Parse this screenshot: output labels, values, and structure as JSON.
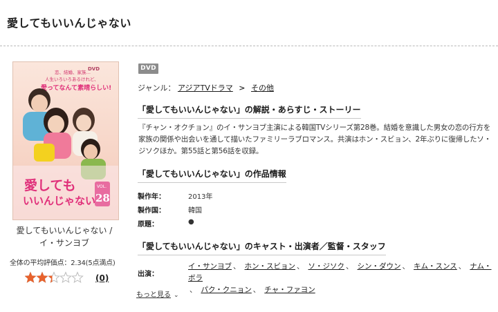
{
  "page": {
    "title": "愛してもいいんじゃない"
  },
  "product": {
    "cover_alt": "愛してもいいんじゃない DVD cover",
    "cover_text": {
      "tagline_line1": "恋、結婚、家族…",
      "tagline_line2": "人生いろいろあるけれど、",
      "tagline_line3": "愛ってなんて素晴らしい!",
      "logo_line1": "愛しても",
      "logo_line2": "いいんじゃない",
      "vol_label": "VOL.",
      "vol_number": "28"
    },
    "name": "愛してもいいんじゃない / イ・サンヨブ",
    "rating_summary": "全体の平均評価点：2.34(5点満点)",
    "rating_value": 2.34,
    "rating_max": 5,
    "review_count": "(0)",
    "format_badge": "DVD"
  },
  "genre": {
    "label": "ジャンル：",
    "items": [
      "アジアTVドラマ",
      "その他"
    ],
    "separator": ">"
  },
  "sections": {
    "synopsis_heading": "「愛してもいいんじゃない」の解説・あらすじ・ストーリー",
    "synopsis_text": "『チャン・オクチョン』のイ・サンヨブ主演による韓国TVシリーズ第28巻。結婚を意識した男女の恋の行方を家族の関係や出会いを通して描いたファミリーラブロマンス。共演はホン・スビョン、2年ぶりに復帰したソ・ジソクほか。第55話と第56話を収録。",
    "info_heading": "「愛してもいいんじゃない」の作品情報",
    "cast_heading": "「愛してもいいんじゃない」のキャスト・出演者／監督・スタッフ"
  },
  "info": {
    "year_label": "製作年：",
    "year_value": "2013年",
    "country_label": "製作国：",
    "country_value": "韓国",
    "original_label": "原題：",
    "original_value": "●"
  },
  "cast": {
    "label": "出演：",
    "names": [
      "イ・サンヨブ",
      "ホン・スビョン",
      "ソ・ジソク",
      "シン・ダウン",
      "キム・スンス",
      "ナム・ボラ",
      "パク・クニョン",
      "チャ・ファヨン"
    ],
    "comma": "、",
    "more_label": "もっと見る"
  },
  "colors": {
    "star_filled": "#e8622c",
    "star_empty": "#bdbdbd",
    "badge_bg": "#8c8c8c",
    "cover_bg": "#f6d6c7",
    "cover_logo": "#e0307a"
  }
}
